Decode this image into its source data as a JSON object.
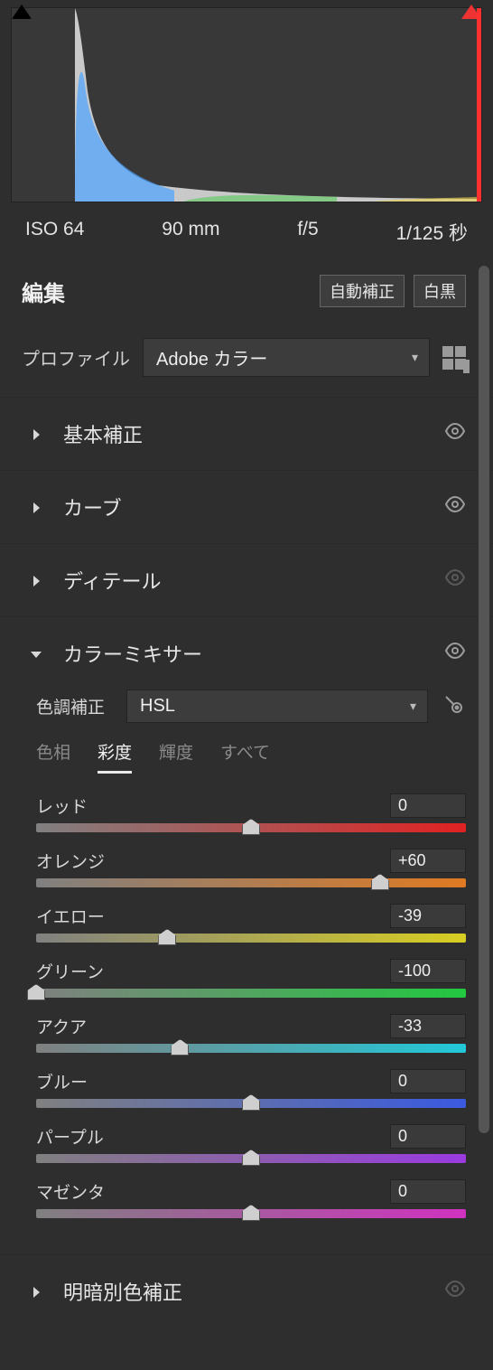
{
  "histogram": {
    "clip_left_active": false,
    "clip_right_active": true
  },
  "exif": {
    "iso": "ISO 64",
    "focal": "90 mm",
    "aperture": "f/5",
    "shutter": "1/125 秒"
  },
  "edit": {
    "title": "編集",
    "auto_btn": "自動補正",
    "bw_btn": "白黒"
  },
  "profile": {
    "label": "プロファイル",
    "value": "Adobe カラー"
  },
  "panels": {
    "basic": {
      "title": "基本補正",
      "expanded": false,
      "enabled": true
    },
    "curve": {
      "title": "カーブ",
      "expanded": false,
      "enabled": true
    },
    "detail": {
      "title": "ディテール",
      "expanded": false,
      "enabled": false
    },
    "mixer": {
      "title": "カラーミキサー",
      "expanded": true,
      "enabled": true
    },
    "split": {
      "title": "明暗別色補正",
      "expanded": false,
      "enabled": false
    }
  },
  "mixer": {
    "adjust_label": "色調補正",
    "mode": "HSL",
    "tabs": {
      "hue": "色相",
      "sat": "彩度",
      "lum": "輝度",
      "all": "すべて"
    },
    "active_tab": "sat",
    "sliders": [
      {
        "key": "red",
        "label": "レッド",
        "value": "0",
        "pct": 50,
        "grad": "g-red"
      },
      {
        "key": "orange",
        "label": "オレンジ",
        "value": "+60",
        "pct": 80,
        "grad": "g-orange"
      },
      {
        "key": "yellow",
        "label": "イエロー",
        "value": "-39",
        "pct": 30.5,
        "grad": "g-yellow"
      },
      {
        "key": "green",
        "label": "グリーン",
        "value": "-100",
        "pct": 0,
        "grad": "g-green"
      },
      {
        "key": "aqua",
        "label": "アクア",
        "value": "-33",
        "pct": 33.5,
        "grad": "g-aqua"
      },
      {
        "key": "blue",
        "label": "ブルー",
        "value": "0",
        "pct": 50,
        "grad": "g-blue"
      },
      {
        "key": "purple",
        "label": "パープル",
        "value": "0",
        "pct": 50,
        "grad": "g-purple"
      },
      {
        "key": "magenta",
        "label": "マゼンタ",
        "value": "0",
        "pct": 50,
        "grad": "g-magenta"
      }
    ]
  }
}
